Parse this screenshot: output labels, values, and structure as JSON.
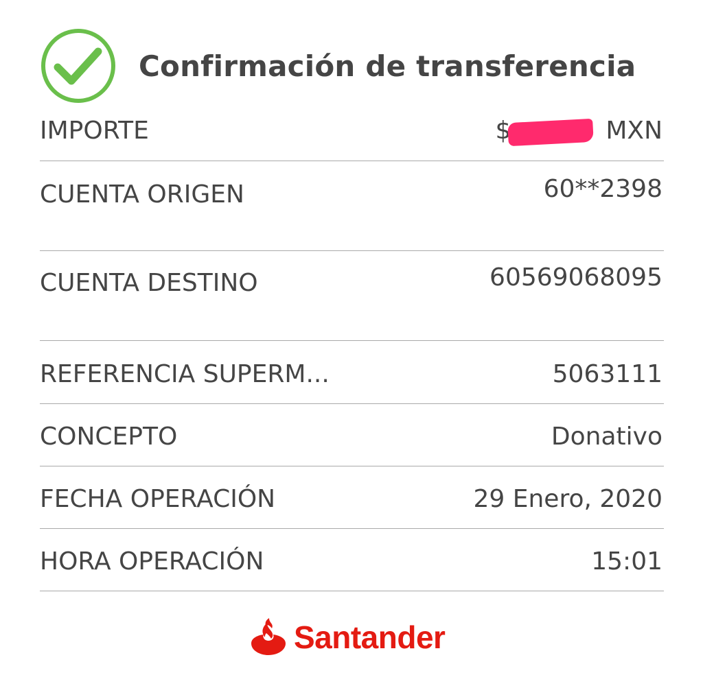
{
  "header": {
    "title": "Confirmación de transferencia",
    "icon": "check-circle-icon"
  },
  "rows": [
    {
      "label": "IMPORTE",
      "value_prefix": "$",
      "value_redacted": true,
      "value_suffix": "MXN"
    },
    {
      "label": "CUENTA ORIGEN",
      "value": "60**2398"
    },
    {
      "label": "CUENTA DESTINO",
      "value": "60569068095"
    },
    {
      "label": "REFERENCIA SUPERM...",
      "value": "5063111"
    },
    {
      "label": "CONCEPTO",
      "value": "Donativo"
    },
    {
      "label": "FECHA OPERACIÓN",
      "value": "29 Enero, 2020"
    },
    {
      "label": "HORA OPERACIÓN",
      "value": "15:01"
    }
  ],
  "brand": {
    "name": "Santander",
    "icon": "flame-icon"
  },
  "colors": {
    "success": "#6abf4b",
    "brand": "#e41b12",
    "redaction": "#ff2a6d",
    "text": "#454545",
    "divider": "#a9a9a9"
  }
}
